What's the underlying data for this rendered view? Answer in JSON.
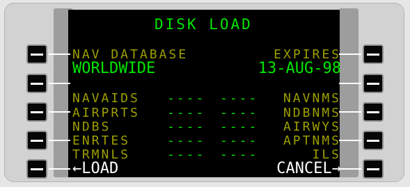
{
  "screen": {
    "title": "DISK LOAD",
    "header_left_label": "NAV DATABASE",
    "header_left_value": "WORLDWIDE",
    "header_right_label": "EXPIRES",
    "header_right_value": "13-AUG-98",
    "rows": [
      {
        "left": "NAVAIDS",
        "left_dashes": "----",
        "right_dashes": "----",
        "right": "NAVNMS"
      },
      {
        "left": "AIRPRTS",
        "left_dashes": "----",
        "right_dashes": "----",
        "right": "NDBNMS"
      },
      {
        "left": "NDBS",
        "left_dashes": "----",
        "right_dashes": "----",
        "right": "AIRWYS"
      },
      {
        "left": "ENRTES",
        "left_dashes": "----",
        "right_dashes": "----",
        "right": "APTNMS"
      },
      {
        "left": "TRMNLS",
        "left_dashes": "----",
        "right_dashes": "----",
        "right": "ILS"
      }
    ],
    "bottom_left": "←LOAD",
    "bottom_right": "CANCEL→"
  },
  "colors": {
    "green": "#00e600",
    "olive": "#9c9e00",
    "white": "#ffffff"
  }
}
